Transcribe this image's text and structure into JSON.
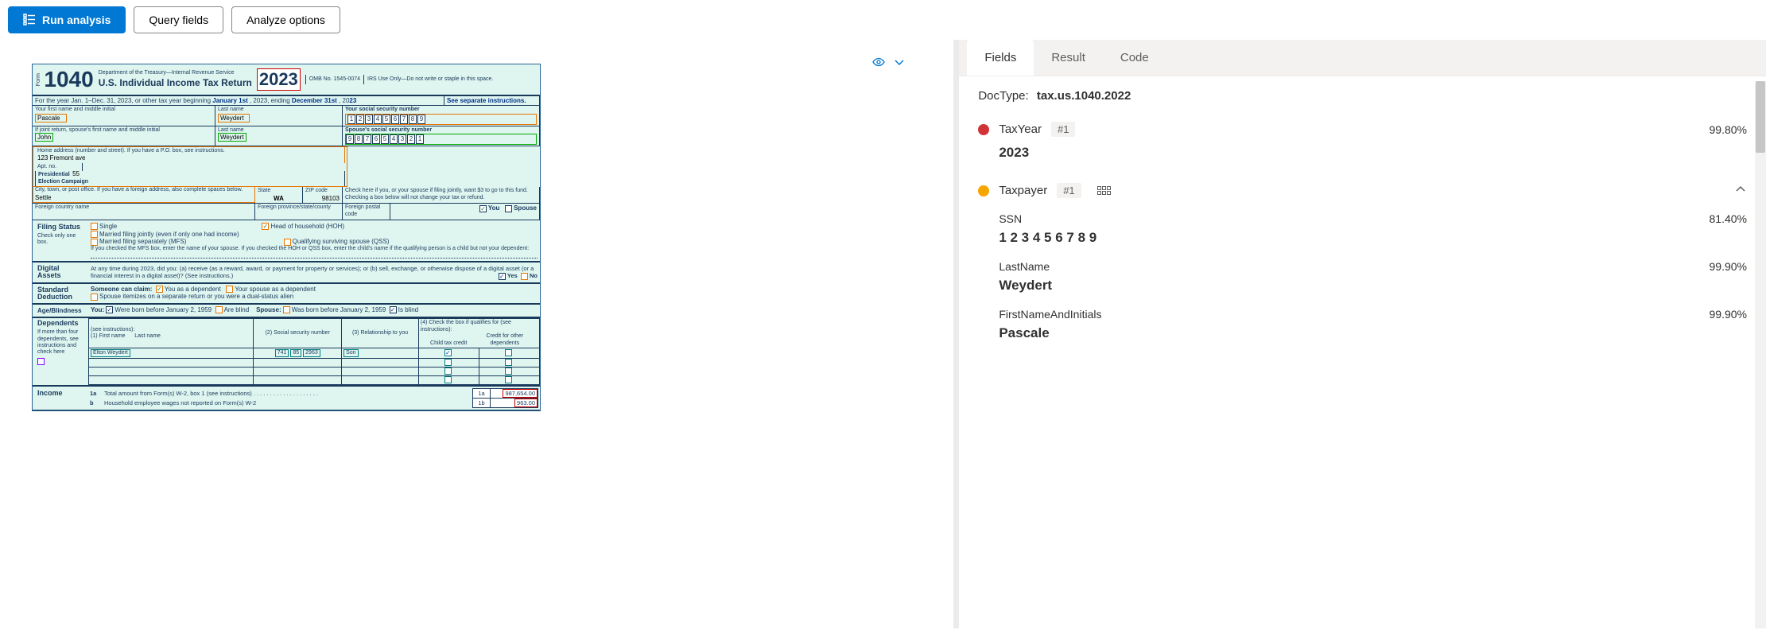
{
  "toolbar": {
    "run_analysis": "Run analysis",
    "query_fields": "Query fields",
    "analyze_options": "Analyze options"
  },
  "tabs": {
    "fields": "Fields",
    "result": "Result",
    "code": "Code"
  },
  "doctype": {
    "label": "DocType:",
    "value": "tax.us.1040.2022"
  },
  "fields": [
    {
      "color": "red",
      "name": "TaxYear",
      "index": "#1",
      "confidence": "99.80%",
      "value": "2023"
    },
    {
      "color": "orange",
      "name": "Taxpayer",
      "index": "#1",
      "confidence": "",
      "value": "",
      "subfields": [
        {
          "name": "SSN",
          "confidence": "81.40%",
          "value": "1 2 3 4 5 6 7 8 9"
        },
        {
          "name": "LastName",
          "confidence": "99.90%",
          "value": "Weydert"
        },
        {
          "name": "FirstNameAndInitials",
          "confidence": "99.90%",
          "value": "Pascale"
        }
      ]
    }
  ],
  "form": {
    "form_no_side": "Form",
    "form_no": "1040",
    "dept": "Department of the Treasury—Internal Revenue Service",
    "title": "U.S. Individual Income Tax Return",
    "year": "2023",
    "omb": "OMB No. 1545-0074",
    "irs_use": "IRS Use Only—Do not write or staple in this space.",
    "year_line": "For the year Jan. 1–Dec. 31, 2023, or other tax year beginning",
    "begin": "January 1st",
    "year2023": ", 2023, ending",
    "end": "December 31st",
    "y20": ", 20",
    "y23": "23",
    "see_instr": "See separate instructions.",
    "first_lbl": "Your first name and middle initial",
    "first": "Pascale",
    "last_lbl": "Last name",
    "last": "Weydert",
    "ssn_lbl": "Your social security number",
    "ssn": [
      "1",
      "2",
      "3",
      "4",
      "5",
      "6",
      "7",
      "8",
      "9"
    ],
    "sp_first_lbl": "If joint return, spouse's first name and middle initial",
    "sp_first": "John",
    "sp_last_lbl": "Last name",
    "sp_last": "Weydert",
    "sp_ssn_lbl": "Spouse's social security number",
    "sp_ssn": [
      "9",
      "8",
      "7",
      "6",
      "5",
      "4",
      "3",
      "2",
      "1"
    ],
    "addr_lbl": "Home address (number and street). If you have a P.O. box, see instructions.",
    "addr": "123 Fremont ave",
    "apt_lbl": "Apt. no.",
    "apt": "55",
    "city_lbl": "City, town, or post office. If you have a foreign address, also complete spaces below.",
    "city": "Settle",
    "state_lbl": "State",
    "state": "WA",
    "zip_lbl": "ZIP code",
    "zip": "98103",
    "foreign_country_lbl": "Foreign country name",
    "foreign_prov_lbl": "Foreign province/state/county",
    "foreign_postal_lbl": "Foreign postal code",
    "pec_title": "Presidential Election Campaign",
    "pec_text": "Check here if you, or your spouse if filing jointly, want $3 to go to this fund. Checking a box below will not change your tax or refund.",
    "you": "You",
    "spouse": "Spouse",
    "filing_status": "Filing Status",
    "check_only": "Check only one box.",
    "single": "Single",
    "mfj": "Married filing jointly (even if only one had income)",
    "mfs": "Married filing separately (MFS)",
    "hoh": "Head of household (HOH)",
    "qss": "Qualifying surviving spouse (QSS)",
    "mfs_note": "If you checked the MFS box, enter the name of your spouse. If you checked the HOH or QSS box, enter the child's name if the qualifying person is a child but not your dependent:",
    "digital": "Digital Assets",
    "digital_text": "At any time during 2023, did you: (a) receive (as a reward, award, or payment for property or services); or (b) sell, exchange, or otherwise dispose of a digital asset (or a financial interest in a digital asset)? (See instructions.)",
    "yes": "Yes",
    "no": "No",
    "std_ded": "Standard Deduction",
    "someone_claim": "Someone can claim:",
    "you_dep": "You as a dependent",
    "sp_dep": "Your spouse as a dependent",
    "itemizes": "Spouse itemizes on a separate return or you were a dual-status alien",
    "age_blind": "Age/Blindness",
    "you_lbl": "You:",
    "born_before": "Were born before January 2, 1959",
    "are_blind": "Are blind",
    "spouse_lbl": "Spouse:",
    "was_born": "Was born before January 2, 1959",
    "is_blind": "Is blind",
    "dependents": "Dependents",
    "dep_instr": "(see instructions):",
    "dep_c1": "(1) First name",
    "dep_c1b": "Last name",
    "dep_c2": "(2) Social security number",
    "dep_c3": "(3) Relationship to you",
    "dep_c4": "(4) Check the box if qualifies for (see instructions):",
    "dep_c4a": "Child tax credit",
    "dep_c4b": "Credit for other dependents",
    "if_more": "If more than four dependents, see instructions and check here",
    "dep1_first": "Elton Weydert",
    "dep1_ssn1": "741",
    "dep1_ssn2": "85",
    "dep1_ssn3": "2963",
    "dep1_rel": "Son",
    "income": "Income",
    "line1a": "1a",
    "line1a_text": "Total amount from Form(s) W-2, box 1 (see instructions)",
    "line1a_amt": "987,654.00",
    "line1b": "b",
    "line1b_text": "Household employee wages not reported on Form(s) W-2",
    "line1b_box": "1b",
    "line1b_amt": "963.00"
  }
}
